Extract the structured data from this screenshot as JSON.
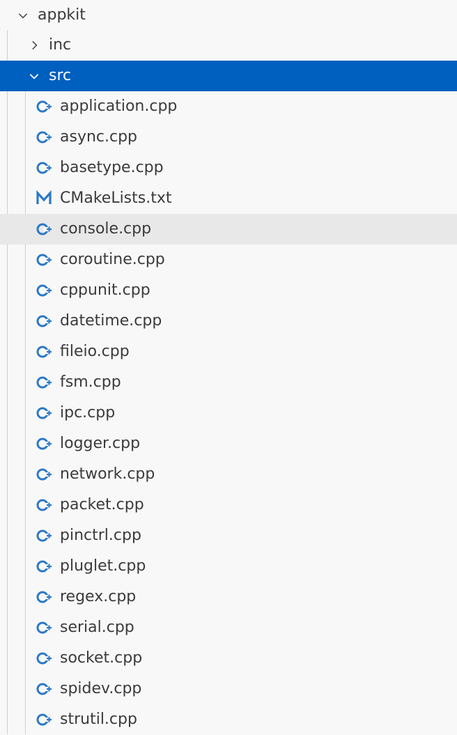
{
  "explorer": {
    "root": {
      "label": "appkit",
      "expanded": true
    },
    "folders": [
      {
        "label": "inc",
        "expanded": false
      },
      {
        "label": "src",
        "expanded": true,
        "selected": true
      }
    ],
    "files": [
      {
        "label": "application.cpp",
        "icon": "cpp-file-icon"
      },
      {
        "label": "async.cpp",
        "icon": "cpp-file-icon"
      },
      {
        "label": "basetype.cpp",
        "icon": "cpp-file-icon"
      },
      {
        "label": "CMakeLists.txt",
        "icon": "cmake-file-icon"
      },
      {
        "label": "console.cpp",
        "icon": "cpp-file-icon",
        "hovered": true
      },
      {
        "label": "coroutine.cpp",
        "icon": "cpp-file-icon"
      },
      {
        "label": "cppunit.cpp",
        "icon": "cpp-file-icon"
      },
      {
        "label": "datetime.cpp",
        "icon": "cpp-file-icon"
      },
      {
        "label": "fileio.cpp",
        "icon": "cpp-file-icon"
      },
      {
        "label": "fsm.cpp",
        "icon": "cpp-file-icon"
      },
      {
        "label": "ipc.cpp",
        "icon": "cpp-file-icon"
      },
      {
        "label": "logger.cpp",
        "icon": "cpp-file-icon"
      },
      {
        "label": "network.cpp",
        "icon": "cpp-file-icon"
      },
      {
        "label": "packet.cpp",
        "icon": "cpp-file-icon"
      },
      {
        "label": "pinctrl.cpp",
        "icon": "cpp-file-icon"
      },
      {
        "label": "pluglet.cpp",
        "icon": "cpp-file-icon"
      },
      {
        "label": "regex.cpp",
        "icon": "cpp-file-icon"
      },
      {
        "label": "serial.cpp",
        "icon": "cpp-file-icon"
      },
      {
        "label": "socket.cpp",
        "icon": "cpp-file-icon"
      },
      {
        "label": "spidev.cpp",
        "icon": "cpp-file-icon"
      },
      {
        "label": "strutil.cpp",
        "icon": "cpp-file-icon"
      }
    ]
  },
  "colors": {
    "background": "#f8f8f8",
    "selection": "#0060c0",
    "hover": "#e8e8e8",
    "cpp_icon": "#2b79c8",
    "cmake_icon": "#2b79c8",
    "text": "#3b3b3b"
  }
}
